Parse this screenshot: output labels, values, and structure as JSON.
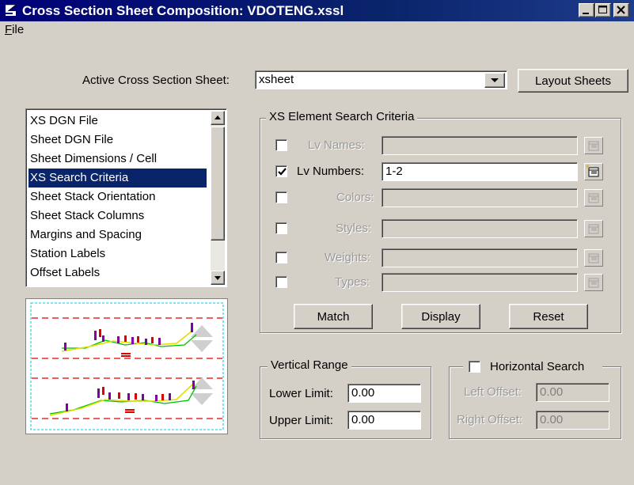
{
  "window": {
    "title": "Cross Section Sheet Composition: VDOTENG.xssl"
  },
  "menu": {
    "file_label": "File",
    "file_mnemonic": "F",
    "file_rest": "ile"
  },
  "sheet": {
    "label": "Active Cross Section Sheet:",
    "value": "xsheet",
    "layout_button": "Layout Sheets"
  },
  "categories": {
    "items": [
      "XS DGN File",
      "Sheet DGN File",
      "Sheet Dimensions / Cell",
      "XS Search Criteria",
      "Sheet Stack Orientation",
      "Sheet Stack Columns",
      "Margins and Spacing",
      "Station Labels",
      "Offset Labels"
    ],
    "selected": "XS Search Criteria"
  },
  "search_criteria": {
    "title": "XS Element Search Criteria",
    "rows": [
      {
        "label": "Lv Names:",
        "checked": false,
        "enabled": false,
        "value": ""
      },
      {
        "label": "Lv Numbers:",
        "checked": true,
        "enabled": true,
        "value": "1-2"
      },
      {
        "label": "Colors:",
        "checked": false,
        "enabled": false,
        "value": ""
      },
      {
        "label": "Styles:",
        "checked": false,
        "enabled": false,
        "value": ""
      },
      {
        "label": "Weights:",
        "checked": false,
        "enabled": false,
        "value": ""
      },
      {
        "label": "Types:",
        "checked": false,
        "enabled": false,
        "value": ""
      }
    ],
    "buttons": {
      "match": "Match",
      "display": "Display",
      "reset": "Reset"
    }
  },
  "vertical_range": {
    "title": "Vertical Range",
    "lower_label": "Lower Limit:",
    "lower_value": "0.00",
    "upper_label": "Upper Limit:",
    "upper_value": "0.00"
  },
  "horizontal_search": {
    "title": "Horizontal Search",
    "checked": false,
    "left_label": "Left Offset:",
    "left_value": "0.00",
    "right_label": "Right Offset:",
    "right_value": "0.00"
  },
  "colors": {
    "titlebar": "#0a246a",
    "face": "#d4d0c8",
    "selection": "#0a246a",
    "preview_margin": "#e00000",
    "preview_border": "#00c8d8",
    "preview_ground": "#00c000",
    "preview_design": "#e0e000"
  }
}
